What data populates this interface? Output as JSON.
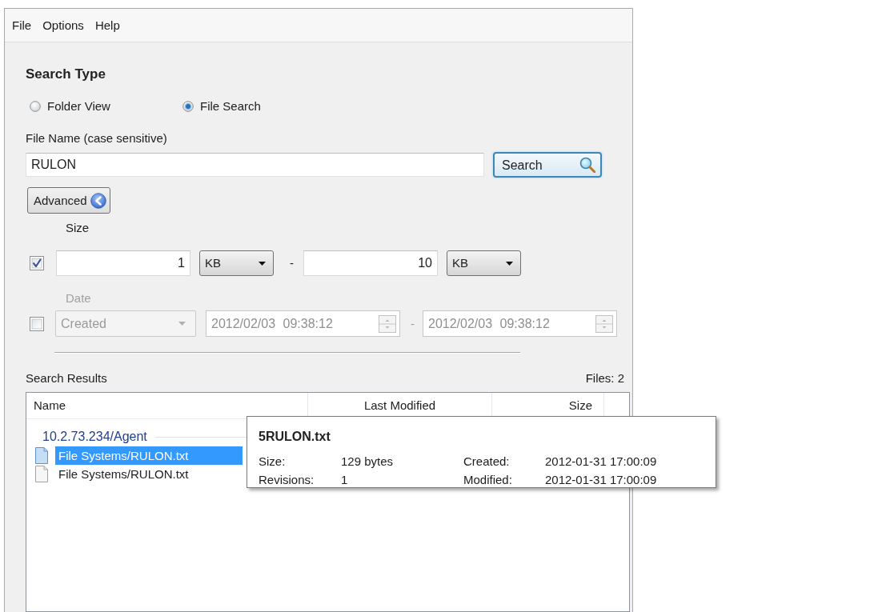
{
  "menu": [
    {
      "label": "File"
    },
    {
      "label": "Options"
    },
    {
      "label": "Help"
    }
  ],
  "search_type": {
    "title": "Search Type",
    "options": [
      {
        "label": "Folder View",
        "selected": false
      },
      {
        "label": "File Search",
        "selected": true
      }
    ]
  },
  "file_name": {
    "label": "File Name (case sensitive)",
    "value": "RULON"
  },
  "search_button": {
    "label": "Search"
  },
  "advanced_button": {
    "label": "Advanced"
  },
  "filters": [
    {
      "kind": "size",
      "label": "Size",
      "checked": true,
      "disabled": false,
      "from": "1",
      "from_unit": "KB",
      "separator": "-",
      "to": "10",
      "to_unit": "KB"
    },
    {
      "kind": "date",
      "label": "Date",
      "checked": false,
      "disabled": true,
      "mode": "Created",
      "from": "2012/02/03 09:38:12",
      "separator": "-",
      "to": "2012/02/03 09:38:12"
    }
  ],
  "results": {
    "title": "Search Results",
    "count": "Files: 2",
    "columns": [
      "Name",
      "Last Modified",
      "Size"
    ],
    "groups": [
      {
        "label": "10.2.73.234/Agent",
        "items": [
          {
            "name": "File Systems/RULON.txt",
            "selected": true
          },
          {
            "name": "File Systems/RULON.txt",
            "selected": false
          }
        ]
      }
    ]
  },
  "tooltip": {
    "title": "5RULON.txt",
    "fields": [
      {
        "label": "Size:",
        "value": "129 bytes"
      },
      {
        "label": "Created:",
        "value": "2012-01-31 17:00:09"
      },
      {
        "label": "Revisions:",
        "value": "1"
      },
      {
        "label": "Modified:",
        "value": "2012-01-31 17:00:09"
      }
    ]
  }
}
